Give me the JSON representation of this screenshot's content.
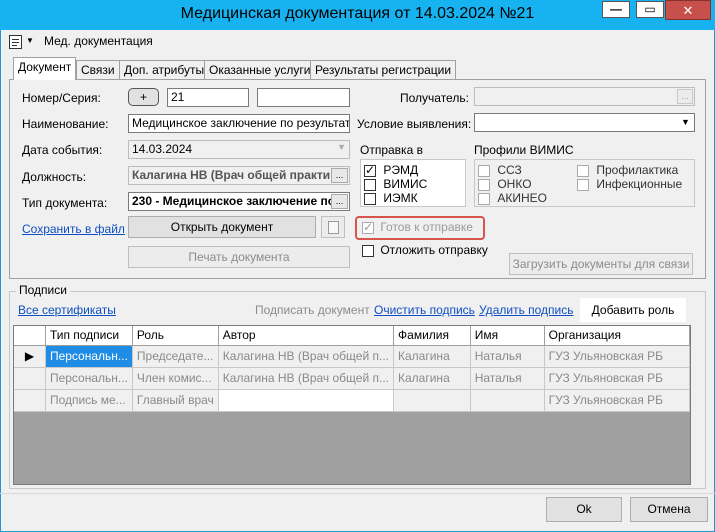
{
  "window": {
    "title": "Медицинская документация от 14.03.2024 №21",
    "minimize": "—",
    "maximize": "▭",
    "close": "✕"
  },
  "toolbar": {
    "menu_label": "Мед. документация"
  },
  "tabs": [
    {
      "label": "Документ",
      "active": true
    },
    {
      "label": "Связи"
    },
    {
      "label": "Доп. атрибуты"
    },
    {
      "label": "Оказанные услуги"
    },
    {
      "label": "Результаты регистрации"
    }
  ],
  "form": {
    "number_label": "Номер/Серия:",
    "plus_button": "+",
    "number_value": "21",
    "series_value": "",
    "name_label": "Наименование:",
    "name_value": "Медицинское заключение по результатам",
    "date_label": "Дата события:",
    "date_value": "14.03.2024",
    "position_label": "Должность:",
    "position_value": "Калагина НВ (Врач общей практи",
    "doctype_label": "Тип документа:",
    "doctype_value": "230 - Медицинское заключение по",
    "save_link": "Сохранить в файл",
    "open_button": "Открыть документ",
    "print_button": "Печать документа",
    "recipient_label": "Получатель:",
    "recipient_value": "",
    "condition_label": "Условие выявления:",
    "condition_value": "",
    "send_label": "Отправка в",
    "send_options": [
      {
        "label": "РЭМД",
        "checked": true
      },
      {
        "label": "ВИМИС",
        "checked": false
      },
      {
        "label": "ИЭМК",
        "checked": false
      }
    ],
    "vimis_label": "Профили ВИМИС",
    "vimis_profiles": [
      {
        "label": "ССЗ",
        "checked": false
      },
      {
        "label": "Профилактика",
        "checked": false
      },
      {
        "label": "ОНКО",
        "checked": false
      },
      {
        "label": "Инфекционные",
        "checked": false
      },
      {
        "label": "АКИНЕО",
        "checked": false
      }
    ],
    "ready_label": "Готов к отправке",
    "ready_checked": true,
    "postpone_label": "Отложить отправку",
    "postpone_checked": false,
    "load_docs_button": "Загрузить документы для связи"
  },
  "signatures": {
    "group_label": "Подписи",
    "all_certs_link": "Все сертификаты",
    "sign_button": "Подписать документ",
    "clear_link": "Очистить подпись",
    "delete_link": "Удалить подпись",
    "add_role_button": "Добавить роль",
    "columns": [
      "Тип подписи",
      "Роль",
      "Автор",
      "Фамилия",
      "Имя",
      "Организация"
    ],
    "rows": [
      [
        "Персональн...",
        "Председате...",
        "Калагина НВ (Врач общей п...",
        "Калагина",
        "Наталья",
        "ГУЗ Ульяновская РБ"
      ],
      [
        "Персональн...",
        "Член комис...",
        "Калагина НВ (Врач общей п...",
        "Калагина",
        "Наталья",
        "ГУЗ Ульяновская РБ"
      ],
      [
        "Подпись ме...",
        "Главный врач",
        "",
        "",
        "",
        "ГУЗ Ульяновская РБ"
      ]
    ]
  },
  "footer": {
    "ok_button": "Ok",
    "cancel_button": "Отмена"
  },
  "colors": {
    "titlebar": "#17b3f0",
    "highlight_box": "#d9534f",
    "selected_cell": "#1f8ce6",
    "link": "#0f4fc2"
  }
}
